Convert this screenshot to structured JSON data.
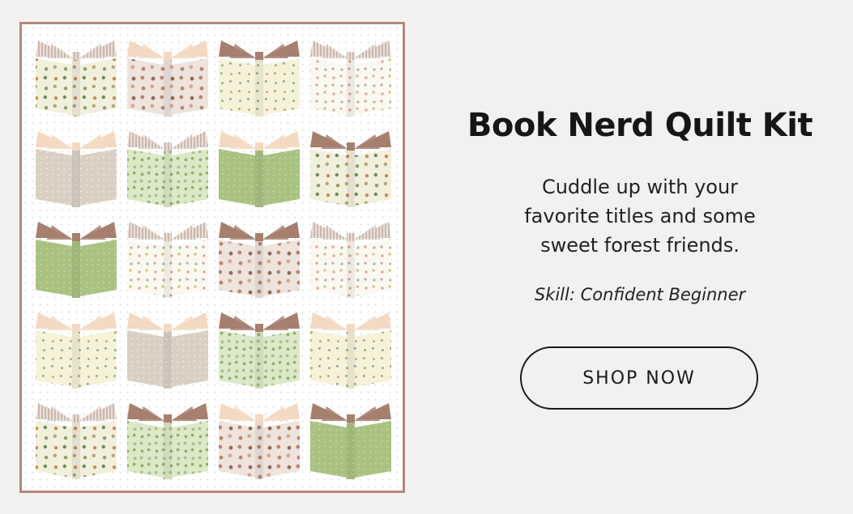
{
  "banner": {
    "title": "Book Nerd Quilt Kit",
    "description_lines": [
      "Cuddle up with your",
      "favorite titles and some",
      "sweet forest friends."
    ],
    "skill": "Skill: Confident Beginner",
    "cta_label": "SHOP NOW"
  },
  "quilt": {
    "border_color": "#b3887a",
    "background_color": "#ffffff",
    "page_colors": {
      "tan": "#f3d9c2",
      "brown": "#a77f6e",
      "stripe": "#cab7ae"
    },
    "rows": [
      [
        {
          "fabric": "cream-forest-scene",
          "pages": "stripe"
        },
        {
          "fabric": "pink-animals",
          "pages": "tan"
        },
        {
          "fabric": "yellow-floral",
          "pages": "brown"
        },
        {
          "fabric": "white-floral",
          "pages": "stripe"
        }
      ],
      [
        {
          "fabric": "taupe-dot",
          "pages": "tan"
        },
        {
          "fabric": "green-leaf",
          "pages": "stripe"
        },
        {
          "fabric": "green-dot",
          "pages": "tan"
        },
        {
          "fabric": "cream-forest-scene",
          "pages": "brown"
        }
      ],
      [
        {
          "fabric": "green-dot",
          "pages": "brown"
        },
        {
          "fabric": "white-floral",
          "pages": "stripe"
        },
        {
          "fabric": "pink-animals",
          "pages": "brown"
        },
        {
          "fabric": "white-floral",
          "pages": "stripe"
        }
      ],
      [
        {
          "fabric": "yellow-floral",
          "pages": "tan"
        },
        {
          "fabric": "taupe-dot",
          "pages": "tan"
        },
        {
          "fabric": "green-leaf",
          "pages": "brown"
        },
        {
          "fabric": "yellow-floral",
          "pages": "tan"
        }
      ],
      [
        {
          "fabric": "cream-forest-scene",
          "pages": "stripe"
        },
        {
          "fabric": "green-leaf",
          "pages": "brown"
        },
        {
          "fabric": "pink-animals",
          "pages": "tan"
        },
        {
          "fabric": "green-dot",
          "pages": "brown"
        }
      ]
    ]
  }
}
